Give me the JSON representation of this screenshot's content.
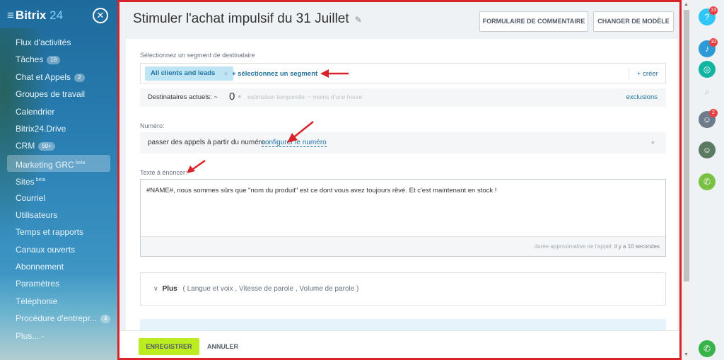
{
  "sidebar": {
    "logo_main": "Bitrix",
    "logo_num": "24",
    "items": [
      {
        "label": "Flux d'activités",
        "badge": "",
        "sup": ""
      },
      {
        "label": "Tâches",
        "badge": "18",
        "sup": ""
      },
      {
        "label": "Chat et Appels",
        "badge": "2",
        "sup": ""
      },
      {
        "label": "Groupes de travail",
        "badge": "",
        "sup": ""
      },
      {
        "label": "Calendrier",
        "badge": "",
        "sup": ""
      },
      {
        "label": "Bitrix24.Drive",
        "badge": "",
        "sup": ""
      },
      {
        "label": "CRM",
        "badge": "50+",
        "sup": ""
      },
      {
        "label": "Marketing GRC",
        "badge": "",
        "sup": "beta"
      },
      {
        "label": "Sites",
        "badge": "",
        "sup": "beta"
      },
      {
        "label": "Courriel",
        "badge": "",
        "sup": ""
      },
      {
        "label": "Utilisateurs",
        "badge": "",
        "sup": ""
      },
      {
        "label": "Temps et rapports",
        "badge": "",
        "sup": ""
      },
      {
        "label": "Canaux ouverts",
        "badge": "",
        "sup": ""
      },
      {
        "label": "Abonnement",
        "badge": "",
        "sup": ""
      },
      {
        "label": "Paramètres",
        "badge": "",
        "sup": ""
      },
      {
        "label": "Téléphonie",
        "badge": "",
        "sup": ""
      },
      {
        "label": "Procédure d'entrepr...",
        "badge": "4",
        "sup": ""
      },
      {
        "label": "Plus... -",
        "badge": "",
        "sup": ""
      }
    ]
  },
  "header": {
    "title": "Stimuler l'achat impulsif du 31 Juillet",
    "btn_comment": "FORMULAIRE DE COMMENTAIRE",
    "btn_change": "CHANGER DE MODÈLE"
  },
  "segment": {
    "label": "Sélectionnez un segment de destinataire",
    "chip": "All clients and leads",
    "select_link": "+ sélectionnez un segment",
    "create_link": "+ créer"
  },
  "recipients": {
    "label": "Destinataires actuels: ~",
    "count": "0",
    "estimate": "estimation temporelle: ~ moins d'une heure",
    "exclusions": "exclusions"
  },
  "number": {
    "label": "Numéro:",
    "text": "passer des appels à partir du numéro",
    "link": "configurer le numéro"
  },
  "speech": {
    "label": "Texte à énoncer:",
    "content": "#NAME#, nous sommes sûrs que \"nom du produit\" est ce dont vous avez toujours rêvé. Et c'est maintenant en stock !",
    "footer_prefix": "durée approximative de l'appel:",
    "footer_value": "il y a 10 secondes"
  },
  "more": {
    "label": "Plus",
    "options": "( Langue et voix ,  Vitesse de parole ,  Volume de parole  )"
  },
  "footer": {
    "save": "ENREGISTRER",
    "cancel": "ANNULER"
  },
  "rightbar": {
    "help_badge": "13",
    "notif_badge": "10",
    "avatar_badge": "2"
  },
  "colors": {
    "accent": "#1f72a1",
    "save": "#bbed21",
    "highlight_border": "#d9232a",
    "arrow": "#d9232a"
  }
}
